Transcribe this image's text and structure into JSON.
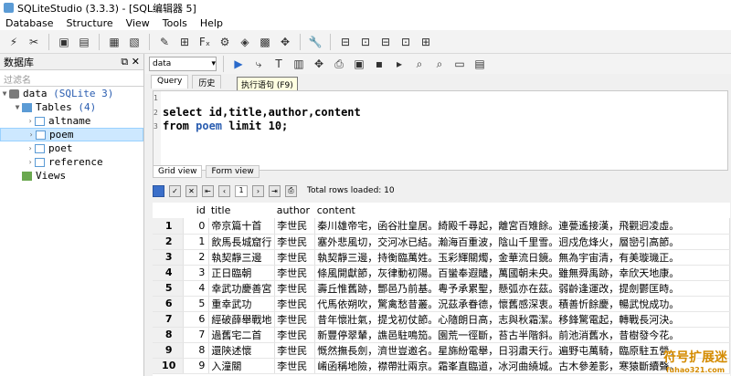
{
  "window": {
    "title": "SQLiteStudio (3.3.3) - [SQL编辑器 5]"
  },
  "menu": [
    "Database",
    "Structure",
    "View",
    "Tools",
    "Help"
  ],
  "sidebar": {
    "title": "数据库",
    "filter_placeholder": "过滤名",
    "db_name": "data",
    "db_type": "(SQLite 3)",
    "tables_label": "Tables",
    "tables_count": "(4)",
    "tables": [
      "altname",
      "poem",
      "poet",
      "reference"
    ],
    "views_label": "Views"
  },
  "editor": {
    "db_select": "data",
    "tabs": [
      "Query",
      "历史"
    ],
    "tooltip": "执行语句 (F9)",
    "line_numbers": [
      "1",
      "2",
      "3"
    ],
    "sql_line1": "select id,title,author,content",
    "sql_line2_kw": "from ",
    "sql_line2_tbl": "poem",
    "sql_line2_rest": " limit 10;",
    "result_tabs": [
      "Grid view",
      "Form view"
    ],
    "page": "1",
    "rows_loaded": "Total rows loaded: 10"
  },
  "grid": {
    "headers": [
      "id",
      "title",
      "author",
      "content"
    ],
    "rows": [
      {
        "n": "1",
        "id": "0",
        "title": "帝京篇十首",
        "author": "李世民",
        "content": "秦川雄帝宅，函谷壯皇居。綺殿千尋起，離宮百雉餘。連甍遙接漢，飛觀迥凌虛。"
      },
      {
        "n": "2",
        "id": "1",
        "title": "飲馬長城窟行",
        "author": "李世民",
        "content": "塞外悲風切，交河冰已結。瀚海百重波，陰山千里雪。迥戍危烽火，層巒引高節。"
      },
      {
        "n": "3",
        "id": "2",
        "title": "執契靜三邊",
        "author": "李世民",
        "content": "執契靜三邊，持衡臨萬姓。玉彩輝關燭，金華流日鏡。無為宇宙清，有美璇璣正。"
      },
      {
        "n": "4",
        "id": "3",
        "title": "正日臨朝",
        "author": "李世民",
        "content": "條風開獻節，灰律動初陽。百蠻奉遐贐，萬國朝未央。雖無舜禹跡，幸欣天地康。"
      },
      {
        "n": "5",
        "id": "4",
        "title": "幸武功慶善宮",
        "author": "李世民",
        "content": "壽丘惟舊跡，酆邑乃前基。粵予承累聖，懸弧亦在茲。弱齡逢運改，提劍鬱匡時。"
      },
      {
        "n": "6",
        "id": "5",
        "title": "重幸武功",
        "author": "李世民",
        "content": "代馬依朔吹，驚禽愁昔叢。況茲承眷德，懷舊感深衷。積善忻餘慶，暢武悅成功。"
      },
      {
        "n": "7",
        "id": "6",
        "title": "經破薛舉戰地",
        "author": "李世民",
        "content": "昔年懷壯氣，提戈初仗節。心隨朗日高，志與秋霜潔。移鋒驚電起，轉戰長河決。"
      },
      {
        "n": "8",
        "id": "7",
        "title": "過舊宅二首",
        "author": "李世民",
        "content": "新豐停翠輦，譙邑駐鳴笳。園荒一徑斷，苔古半階斜。前池消舊水，昔樹發今花。"
      },
      {
        "n": "9",
        "id": "8",
        "title": "還陝述懷",
        "author": "李世民",
        "content": "慨然撫長劍，濟世豈邀名。星旆紛電舉，日羽肅天行。遍野屯萬騎，臨原駐五營。"
      },
      {
        "n": "10",
        "id": "9",
        "title": "入潼關",
        "author": "李世民",
        "content": "崤函稱地險，襟帶壯兩京。霜峯直臨道，冰河曲繞城。古木參差影，寒猿斷續聲。"
      }
    ]
  },
  "watermark": {
    "main": "符号扩展迷",
    "sub": "fuhao321.com"
  }
}
